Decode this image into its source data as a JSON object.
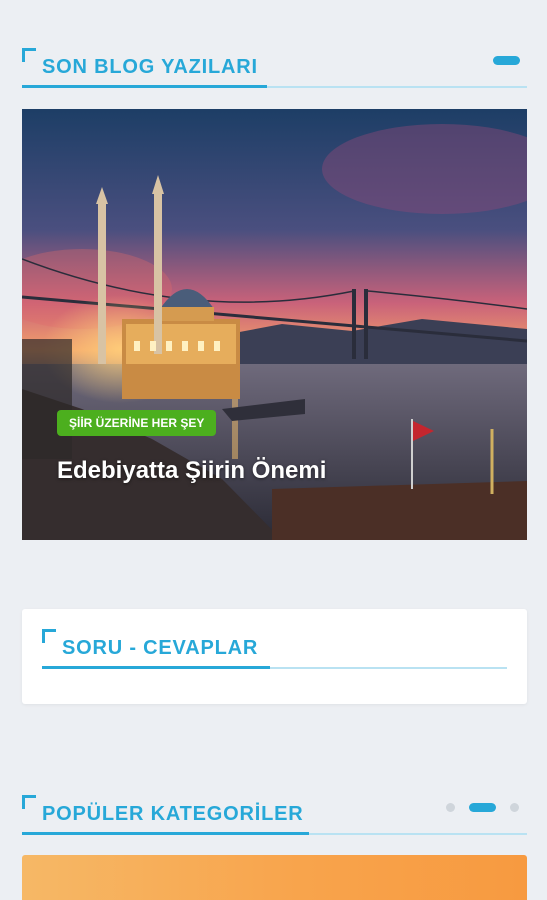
{
  "sections": {
    "blog": {
      "title": "SON BLOG YAZILARI"
    },
    "qa": {
      "title": "SORU - CEVAPLAR"
    },
    "categories": {
      "title": "POPÜLER KATEGORİLER"
    }
  },
  "featured_post": {
    "category_badge": "ŞİİR ÜZERİNE HER ŞEY",
    "title": "Edebiyatta Şiirin Önemi",
    "image_description": "ortakoy-mosque-bosphorus-bridge-sunset"
  },
  "colors": {
    "accent": "#27a8d8",
    "badge": "#4caf1e",
    "background": "#eceff3"
  }
}
